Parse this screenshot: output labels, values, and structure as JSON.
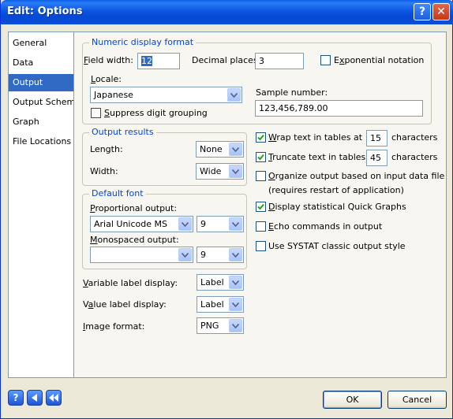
{
  "window": {
    "title": "Edit: Options",
    "help_glyph": "?",
    "close_glyph": "✕"
  },
  "nav": {
    "items": [
      {
        "label": "General",
        "selected": false
      },
      {
        "label": "Data",
        "selected": false
      },
      {
        "label": "Output",
        "selected": true
      },
      {
        "label": "Output Scheme",
        "selected": false
      },
      {
        "label": "Graph",
        "selected": false
      },
      {
        "label": "File Locations",
        "selected": false
      }
    ]
  },
  "numeric": {
    "title": "Numeric display format",
    "field_width_label": "Field width:",
    "field_width_value": "12",
    "decimal_places_label": "Decimal places:",
    "decimal_places_value": "3",
    "exponential_label": "Exponential notation",
    "exponential_checked": false,
    "locale_label": "Locale:",
    "locale_value": "Japanese",
    "sample_label": "Sample number:",
    "sample_value": "123,456,789.00",
    "suppress_label": "Suppress digit grouping",
    "suppress_checked": false
  },
  "output_results": {
    "title": "Output results",
    "length_label": "Length:",
    "length_value": "None",
    "width_label": "Width:",
    "width_value": "Wide"
  },
  "options": {
    "wrap_label": "Wrap text in tables at",
    "wrap_checked": true,
    "wrap_value": "15",
    "wrap_unit": "characters",
    "truncate_label": "Truncate text in tables at",
    "truncate_checked": true,
    "truncate_value": "45",
    "truncate_unit": "characters",
    "organize_label": "Organize output based on input data file",
    "organize_note": "(requires restart of application)",
    "organize_checked": false,
    "display_label": "Display statistical Quick Graphs",
    "display_checked": true,
    "echo_label": "Echo commands in output",
    "echo_checked": false,
    "systat_label": "Use SYSTAT classic output style",
    "systat_checked": false
  },
  "font": {
    "title": "Default font",
    "proportional_label": "Proportional output:",
    "proportional_font": "Arial Unicode MS",
    "proportional_size": "9",
    "monospaced_label": "Monospaced output:",
    "monospaced_font": "",
    "monospaced_size": "9"
  },
  "display": {
    "variable_label": "Variable label display:",
    "variable_value": "Label",
    "value_label": "Value label display:",
    "value_value": "Label",
    "image_label": "Image format:",
    "image_value": "PNG"
  },
  "footer": {
    "help_icon": "help-icon",
    "back_icon": "back-icon",
    "first_icon": "rewind-icon",
    "ok_label": "OK",
    "cancel_label": "Cancel"
  },
  "colors": {
    "title_bar": "#0a54e0",
    "selection": "#316ac5",
    "group_title": "#0046d5"
  }
}
